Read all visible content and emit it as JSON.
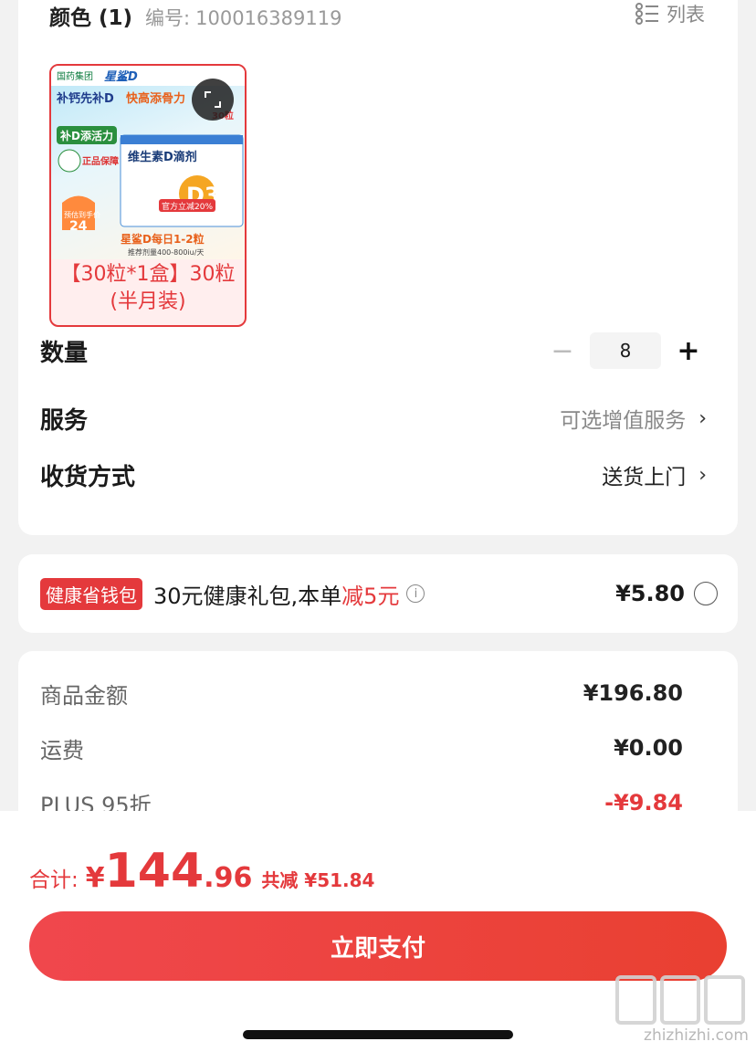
{
  "spec": {
    "color_title": "颜色 (1)",
    "code_label": "编号:",
    "code_value": "100016389119",
    "list_label": "列表",
    "variant_label": "【30粒*1盒】30粒(半月装)",
    "product_image_text": {
      "brand1": "国药集团",
      "brand2": "星鲨D",
      "slogan1": "补钙先补D",
      "slogan2": "快高添骨力",
      "slogan3": "补D添活力",
      "product": "维生素D滴剂",
      "d3": "D3",
      "bonus": "官方立减20%",
      "dosage": "星鲨D每日1-2粒",
      "dose_note": "推荐剂量400-800iu/天",
      "genuine": "正品保障",
      "price_tag": "预估到手价",
      "price_value": "24",
      "count": "30粒"
    }
  },
  "quantity": {
    "label": "数量",
    "value": "8",
    "minus": "−",
    "plus": "+"
  },
  "service": {
    "label": "服务",
    "value": "可选增值服务"
  },
  "delivery": {
    "label": "收货方式",
    "value": "送货上门"
  },
  "coupon": {
    "badge": "健康省钱包",
    "text_main": "30元健康礼包,本单",
    "text_red": "减5元",
    "price": "¥5.80"
  },
  "amounts": [
    {
      "label": "商品金额",
      "value": "¥196.80"
    },
    {
      "label": "运费",
      "value": "¥0.00"
    },
    {
      "label": "PLUS 95折",
      "value": "-¥9.84"
    }
  ],
  "footer": {
    "total_label": "合计:",
    "currency": "¥",
    "total_int": "144",
    "total_dec": ".96",
    "saved": "共减 ¥51.84",
    "pay_button": "立即支付"
  },
  "watermark": {
    "text": "zhizhizhi.com"
  },
  "colors": {
    "accent": "#e4393c",
    "background": "#f2f2f2"
  }
}
